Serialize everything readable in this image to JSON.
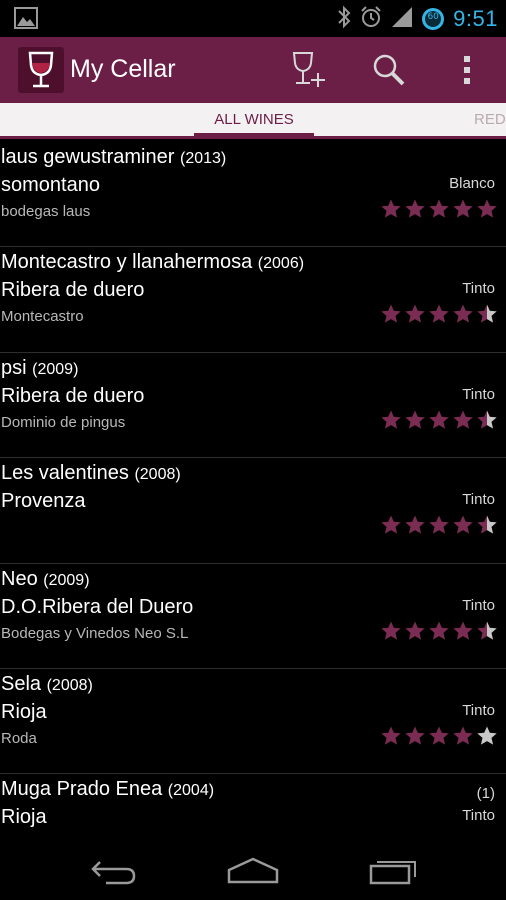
{
  "status_bar": {
    "time": "9:51",
    "icons": [
      "image-notification-icon",
      "bluetooth-icon",
      "alarm-icon",
      "signal-icon",
      "battery-icon"
    ],
    "battery_level": "60"
  },
  "action_bar": {
    "title": "My Cellar",
    "icons": [
      "wine-glass-logo-icon",
      "add-wine-icon",
      "search-icon",
      "overflow-menu-icon"
    ]
  },
  "tabs": [
    {
      "label": "ALL WINES",
      "active": true
    },
    {
      "label": "RED",
      "active": false
    }
  ],
  "colors": {
    "accent": "#6b1f47",
    "star_filled": "#7a2c52",
    "star_empty": "#c8c8c8",
    "status_time": "#33b5e5"
  },
  "wines": [
    {
      "name": "laus gewustraminer",
      "year": "(2013)",
      "region": "somontano",
      "winery": "bodegas laus",
      "type": "Blanco",
      "count": "",
      "rating": 5
    },
    {
      "name": "Montecastro y llanahermosa",
      "year": "(2006)",
      "region": "Ribera de duero",
      "winery": "Montecastro",
      "type": "Tinto",
      "count": "",
      "rating": 4.5
    },
    {
      "name": "psi",
      "year": "(2009)",
      "region": "Ribera de duero",
      "winery": "Dominio de pingus",
      "type": "Tinto",
      "count": "",
      "rating": 4.5
    },
    {
      "name": "Les valentines",
      "year": "(2008)",
      "region": "Provenza",
      "winery": "",
      "type": "Tinto",
      "count": "",
      "rating": 4.5
    },
    {
      "name": "Neo",
      "year": "(2009)",
      "region": "D.O.Ribera del Duero",
      "winery": "Bodegas y Vinedos Neo S.L",
      "type": "Tinto",
      "count": "",
      "rating": 4.5
    },
    {
      "name": "Sela",
      "year": "(2008)",
      "region": "Rioja",
      "winery": "Roda",
      "type": "Tinto",
      "count": "",
      "rating": 4
    },
    {
      "name": "Muga Prado Enea",
      "year": "(2004)",
      "region": "Rioja",
      "winery": "",
      "type": "Tinto",
      "count": "(1)",
      "rating": 0
    }
  ],
  "nav_bar": {
    "icons": [
      "back-icon",
      "home-icon",
      "recent-apps-icon"
    ]
  }
}
